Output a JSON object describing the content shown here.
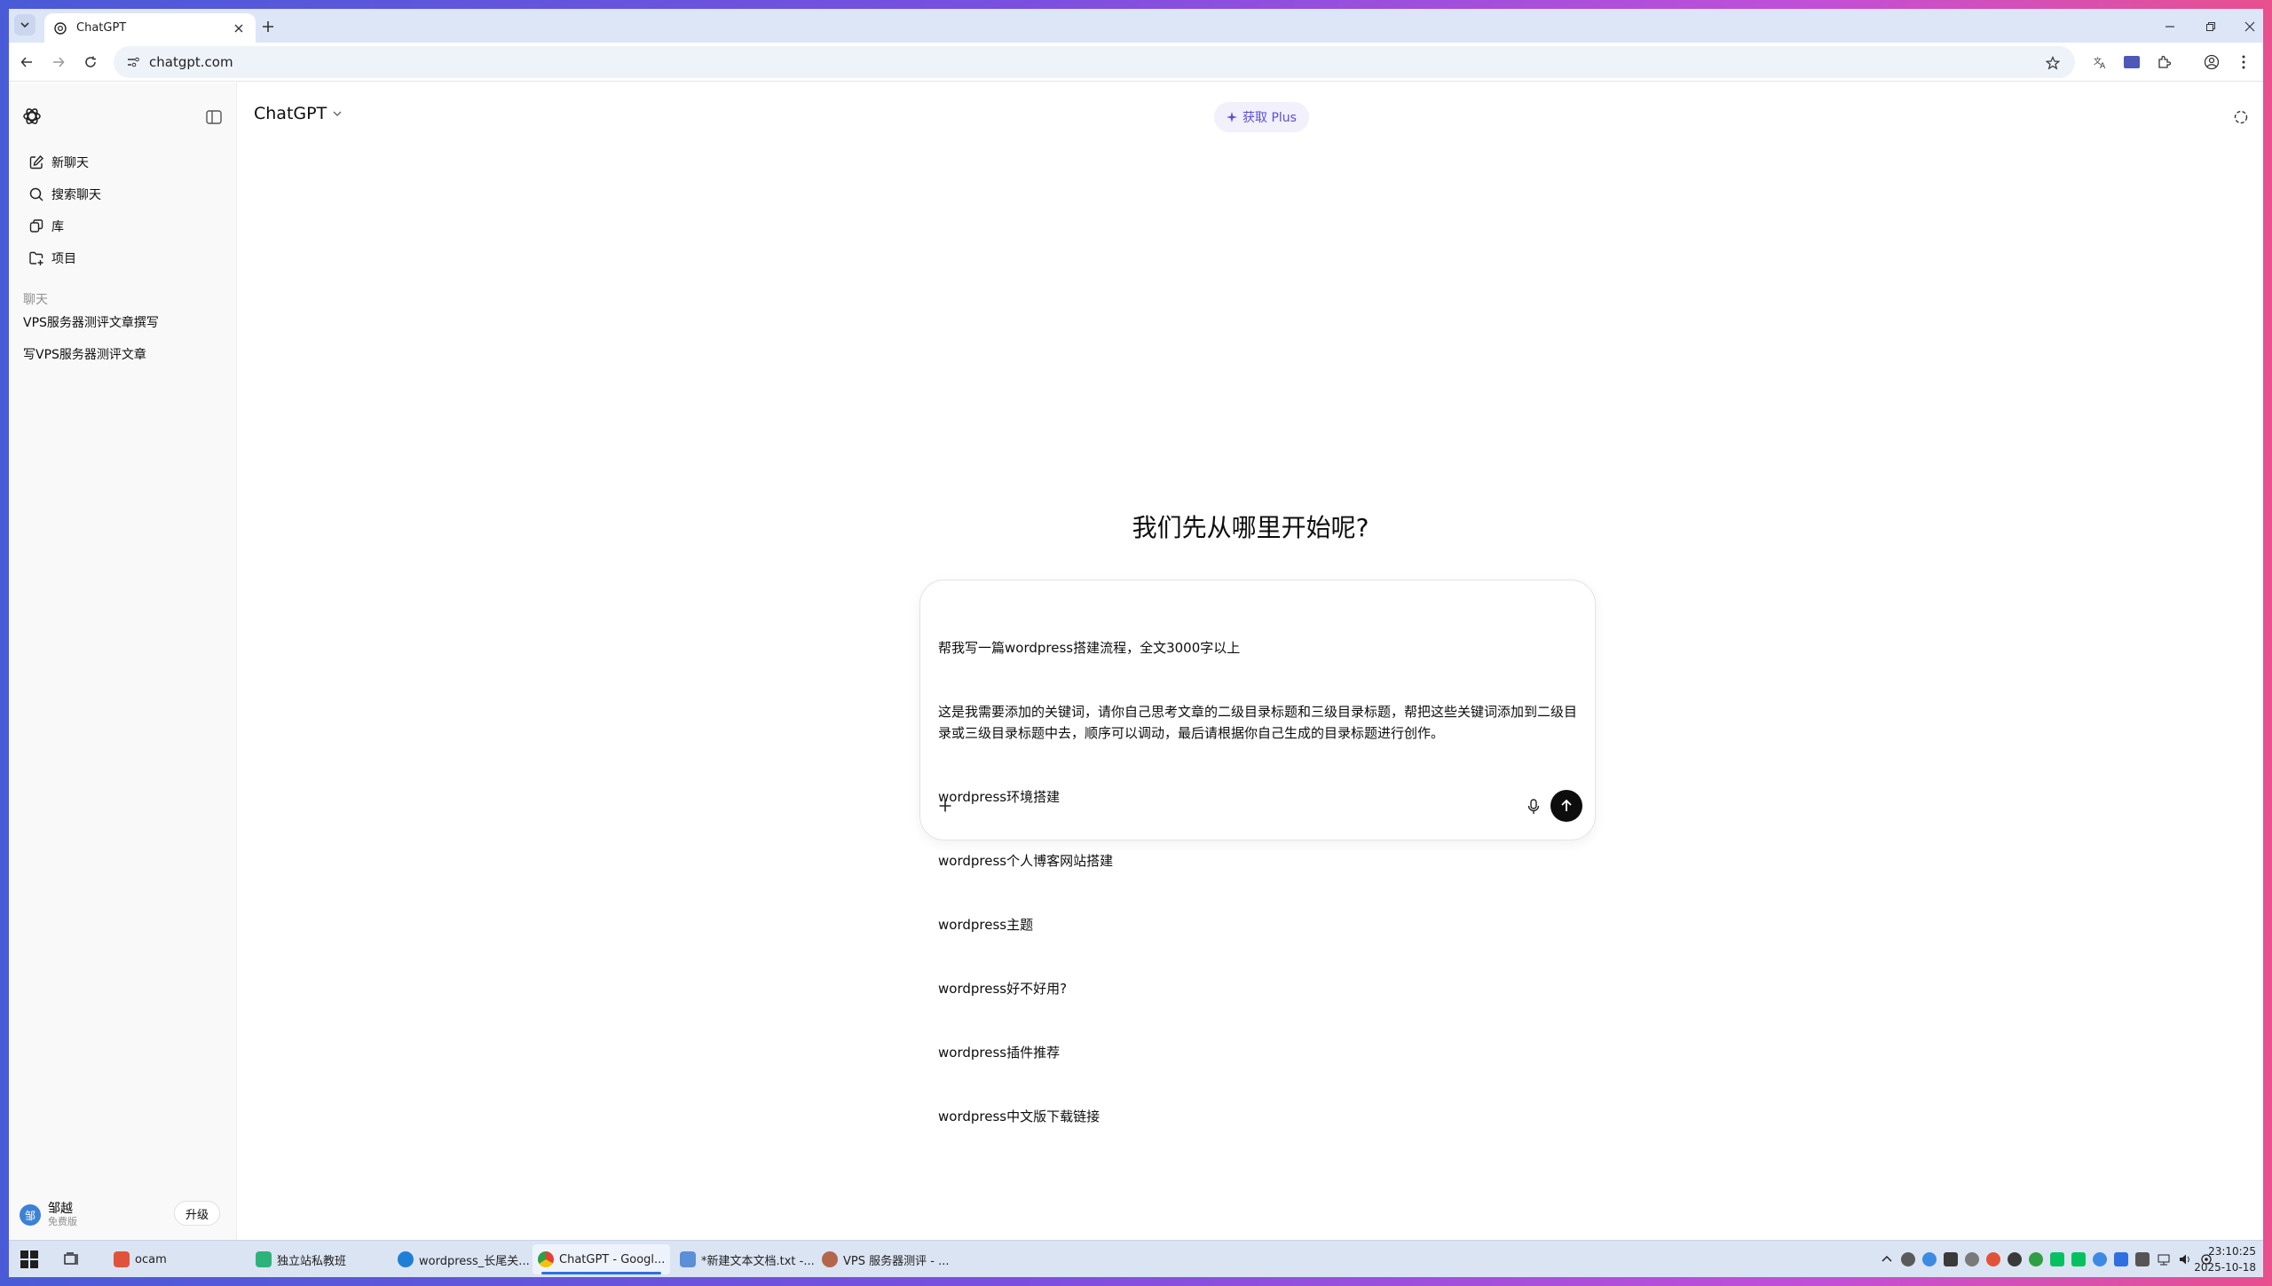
{
  "browser": {
    "tab": {
      "title": "ChatGPT"
    },
    "address": {
      "url": "chatgpt.com"
    }
  },
  "sidebar": {
    "nav": [
      {
        "label": "新聊天",
        "icon": "new-chat-icon"
      },
      {
        "label": "搜索聊天",
        "icon": "search-icon"
      },
      {
        "label": "库",
        "icon": "library-icon"
      },
      {
        "label": "项目",
        "icon": "folder-plus-icon"
      }
    ],
    "section_title": "聊天",
    "chats": [
      "VPS服务器测评文章撰写",
      "写VPS服务器测评文章"
    ],
    "user": {
      "avatar_letter": "邹",
      "name": "邹越",
      "plan": "免费版",
      "upgrade_label": "升级"
    }
  },
  "main": {
    "model_name": "ChatGPT",
    "get_plus_label": "获取 Plus",
    "headline": "我们先从哪里开始呢?",
    "composer_lines": [
      "帮我写一篇wordpress搭建流程，全文3000字以上",
      "这是我需要添加的关键词，请你自己思考文章的二级目录标题和三级目录标题，帮把这些关键词添加到二级目录或三级目录标题中去，顺序可以调动，最后请根据你自己生成的目录标题进行创作。",
      "wordpress环境搭建",
      "wordpress个人博客网站搭建",
      "wordpress主题",
      "wordpress好不好用?",
      "wordpress插件推荐",
      "wordpress中文版下载链接"
    ]
  },
  "taskbar": {
    "apps": [
      {
        "label": "ocam",
        "color": "#e0533a"
      },
      {
        "label": "独立站私教班",
        "color": "#2db37a"
      },
      {
        "label": "wordpress_长尾关...",
        "color": "#1f7fd6"
      },
      {
        "label": "ChatGPT - Googl...",
        "color": "#e44134"
      },
      {
        "label": "*新建文本文档.txt -...",
        "color": "#5b8fd8"
      },
      {
        "label": "VPS 服务器测评 - ...",
        "color": "#b4664a"
      }
    ],
    "time": "23:10:25",
    "date": "2025-10-18"
  },
  "colors": {
    "accent": "#5b4fd6",
    "send_button": "#0d0d0d",
    "taskbar_active": "#2f6fe0"
  }
}
